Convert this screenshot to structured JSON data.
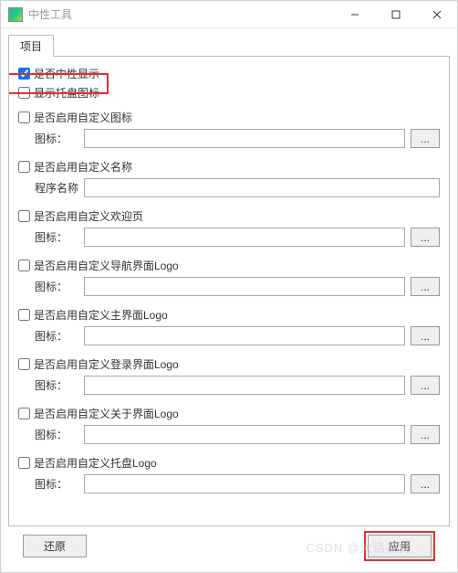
{
  "titlebar": {
    "title": "中性工具"
  },
  "tabs": {
    "items": [
      {
        "label": "项目"
      }
    ]
  },
  "top": {
    "check1_label": "是否中性显示",
    "check1_checked": true,
    "check2_label": "显示托盘图标",
    "check2_checked": false
  },
  "sections": [
    {
      "check_label": "是否启用自定义图标",
      "field_label": "图标：",
      "with_browse": true
    },
    {
      "check_label": "是否启用自定义名称",
      "field_label": "程序名称",
      "with_browse": false
    },
    {
      "check_label": "是否启用自定义欢迎页",
      "field_label": "图标：",
      "with_browse": true
    },
    {
      "check_label": "是否启用自定义导航界面Logo",
      "field_label": "图标：",
      "with_browse": true
    },
    {
      "check_label": "是否启用自定义主界面Logo",
      "field_label": "图标：",
      "with_browse": true
    },
    {
      "check_label": "是否启用自定义登录界面Logo",
      "field_label": "图标：",
      "with_browse": true
    },
    {
      "check_label": "是否启用自定义关于界面Logo",
      "field_label": "图标：",
      "with_browse": true
    },
    {
      "check_label": "是否启用自定义托盘Logo",
      "field_label": "图标：",
      "with_browse": true
    }
  ],
  "buttons": {
    "restore": "还原",
    "apply": "应用",
    "browse": "..."
  },
  "watermark": "CSDN @大话视觉"
}
